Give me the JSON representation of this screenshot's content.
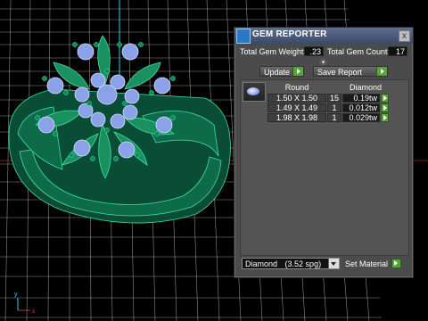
{
  "panel": {
    "title": "GEM REPORTER",
    "close_label": "x",
    "total_weight_label": "Total Gem Weight",
    "total_weight_value": ".23",
    "total_count_label": "Total Gem Count",
    "total_count_value": "17",
    "update_label": "Update",
    "save_report_label": "Save Report",
    "table": {
      "headers": [
        "Round",
        "Diamond"
      ],
      "rows": [
        {
          "size": "1.50 X 1.50",
          "count": "15",
          "weight": "0.19tw"
        },
        {
          "size": "1.49 X 1.49",
          "count": "1",
          "weight": "0.012tw"
        },
        {
          "size": "1.98 X 1.98",
          "count": "1",
          "weight": "0.029tw"
        }
      ]
    },
    "material": {
      "selected": "Diamond",
      "detail": "(3.52 spg)",
      "set_label": "Set Material"
    }
  },
  "viewport": {
    "axis_labels": {
      "y": "y",
      "x": "x"
    }
  },
  "colors": {
    "ring_green": "#2fb87a",
    "stone_blue": "#8aa2e8",
    "grid": "#ffffff",
    "accent_green": "#5aa33a"
  }
}
